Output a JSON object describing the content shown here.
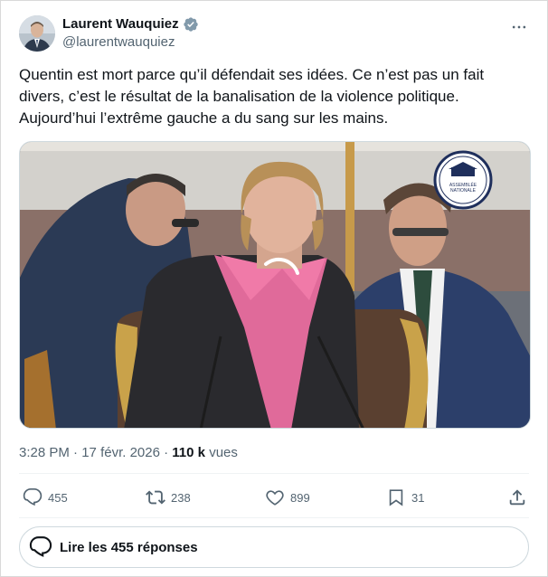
{
  "author": {
    "display_name": "Laurent Wauquiez",
    "handle": "@laurentwauquiez",
    "verified": true
  },
  "tweet": {
    "text": "Quentin est mort parce qu’il défendait ses idées. Ce n’est pas un fait divers, c’est le résultat de la banalisation de la violence politique. Aujourd’hui l’extrême gauche a du sang sur les mains."
  },
  "media": {
    "watermark_text": "ASSEMBLÉE NATIONALE",
    "loading": true
  },
  "meta": {
    "time": "3:28 PM",
    "separator": "·",
    "date": "17 févr. 2026",
    "views_count": "110 k",
    "views_label": "vues"
  },
  "actions": {
    "replies": "455",
    "retweets": "238",
    "likes": "899",
    "bookmarks": "31"
  },
  "replies_button": {
    "label": "Lire les 455 réponses"
  },
  "colors": {
    "text": "#0f1419",
    "secondary": "#536471",
    "verified": "#829aab",
    "border": "#cfd9de"
  },
  "icons": [
    "verified-badge-icon",
    "more-icon",
    "reply-icon",
    "retweet-icon",
    "like-icon",
    "bookmark-icon",
    "share-icon",
    "speech-bubble-icon",
    "loading-spinner-icon"
  ]
}
